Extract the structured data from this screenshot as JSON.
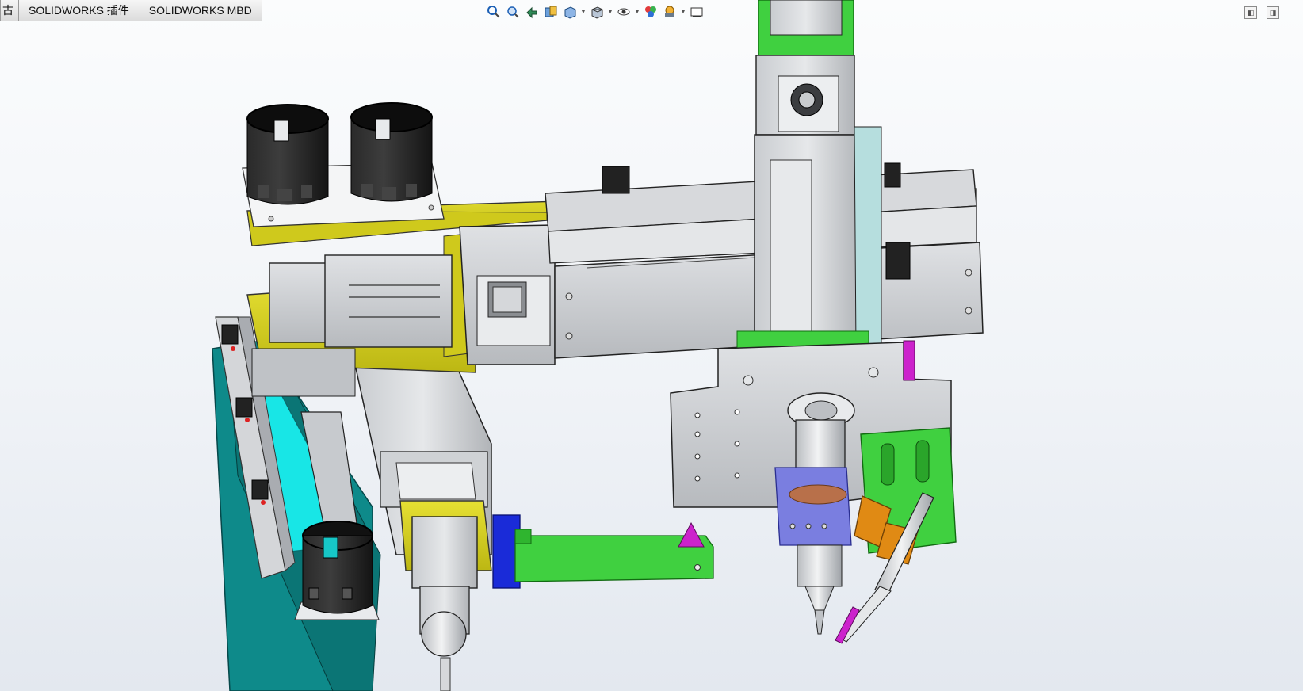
{
  "tabs": [
    {
      "label": "古",
      "cut": true
    },
    {
      "label": "SOLIDWORKS 插件"
    },
    {
      "label": "SOLIDWORKS MBD"
    }
  ],
  "heads_up_toolbar": [
    "zoom-to-fit-icon",
    "zoom-to-area-icon",
    "previous-view-icon",
    "section-view-icon",
    "view-orientation-icon",
    "display-style-icon",
    "hide-show-items-icon",
    "edit-appearance-icon",
    "apply-scene-icon",
    "view-settings-icon"
  ],
  "window_controls": [
    "tile-left-icon",
    "tile-right-icon"
  ],
  "colors": {
    "yellow_plate": "#d8d21a",
    "gray_metal": "#c4c7cb",
    "green_part": "#40d040",
    "cyan_plate": "#18e6e6",
    "teal_frame": "#0e8a8a",
    "black_cup": "#1c1c1c",
    "orange_bracket": "#e08a14",
    "magenta_tip": "#cc22cc",
    "blue_block": "#1a2bd8",
    "lavender_holder": "#7a7ee0"
  }
}
